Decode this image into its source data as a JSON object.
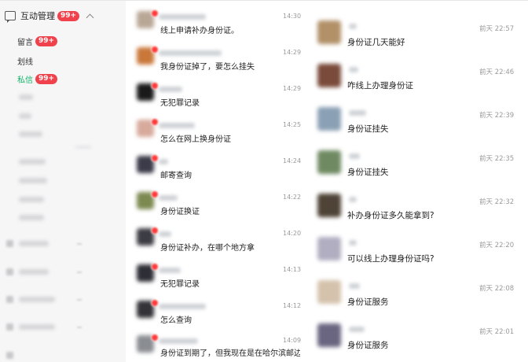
{
  "sidebar": {
    "title": "互动管理",
    "title_badge": "99+",
    "items": [
      {
        "label": "留言",
        "badge": "99+"
      },
      {
        "label": "划线",
        "badge": ""
      },
      {
        "label": "私信",
        "badge": "99+"
      }
    ]
  },
  "left_messages": [
    {
      "time": "14:30",
      "text": "线上申请补办身份证。"
    },
    {
      "time": "14:29",
      "text": "我身份证掉了，要怎么挂失"
    },
    {
      "time": "14:29",
      "text": "无犯罪记录"
    },
    {
      "time": "14:25",
      "text": "怎么在网上换身份证"
    },
    {
      "time": "14:24",
      "text": "邮寄查询"
    },
    {
      "time": "14:22",
      "text": "身份证换证"
    },
    {
      "time": "14:20",
      "text": "身份证补办，在哪个地方拿"
    },
    {
      "time": "14:13",
      "text": "无犯罪记录"
    },
    {
      "time": "14:12",
      "text": "怎么查询"
    },
    {
      "time": "14:09",
      "text": "身份证到期了，但我现在是在哈尔滨邮边的该..."
    }
  ],
  "right_messages": [
    {
      "time": "前天 22:57",
      "text": "身份证几天能好"
    },
    {
      "time": "前天 22:46",
      "text": "咋线上办理身份证"
    },
    {
      "time": "前天 22:39",
      "text": "身份证挂失"
    },
    {
      "time": "前天 22:35",
      "text": "身份证挂失"
    },
    {
      "time": "前天 22:32",
      "text": "补办身份证多久能拿到?"
    },
    {
      "time": "前天 22:20",
      "text": "可以线上办理身份证吗?"
    },
    {
      "time": "前天 22:08",
      "text": "身份证服务"
    },
    {
      "time": "前天 22:01",
      "text": "身份证服务"
    }
  ],
  "colors": {
    "accent": "#13b36a",
    "badge": "#f0424d"
  }
}
